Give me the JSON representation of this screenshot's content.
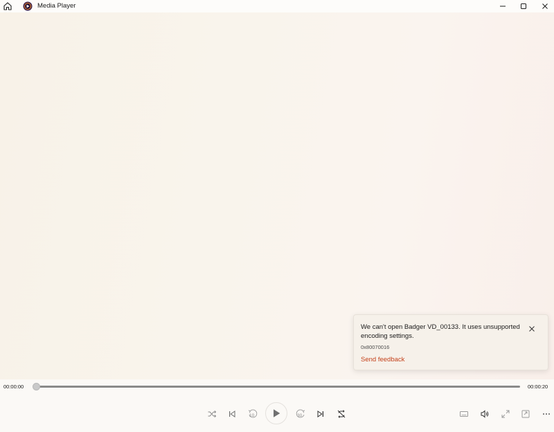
{
  "window": {
    "title": "Media Player",
    "icons": {
      "home": "home-icon",
      "app": "media-player-app-icon",
      "minimize": "minimize-icon",
      "maximize": "maximize-icon",
      "close": "close-icon"
    }
  },
  "toast": {
    "message": "We can't open Badger VD_00133. It uses unsupported encoding settings.",
    "code": "0x80070016",
    "link": "Send feedback",
    "link_color": "#c4411a"
  },
  "playback": {
    "current_time": "00:00:00",
    "total_time": "00:00:20",
    "progress": 0
  },
  "controls": {
    "left_group": [
      "shuffle-icon",
      "previous-icon",
      "rewind-10-icon",
      "play-icon",
      "forward-30-icon",
      "next-icon",
      "repeat-off-icon"
    ],
    "right_group": [
      "captions-icon",
      "volume-icon",
      "fullscreen-icon",
      "mini-player-icon",
      "more-icon"
    ],
    "rewind_label": "10",
    "forward_label": "30"
  }
}
